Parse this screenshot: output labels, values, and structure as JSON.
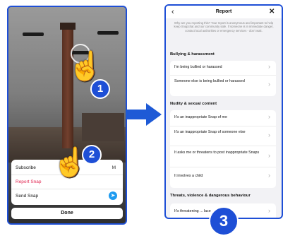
{
  "left_phone": {
    "action_sheet": {
      "subscribe": "Subscribe",
      "subscribe_count": "M",
      "report": "Report Snap",
      "send": "Send Snap",
      "done": "Done"
    }
  },
  "steps": [
    "1",
    "2",
    "3"
  ],
  "right_phone": {
    "title": "Report",
    "intro": "Why are you reporting this? Your report is anonymous and important to help keep Snapchat and our community safe. If someone is in immediate danger, contact local authorities or emergency services - don't wait.",
    "sections": [
      {
        "title": "Bullying & harassment",
        "options": [
          "I'm being bullied or harassed",
          "Someone else is being bullied or harassed"
        ]
      },
      {
        "title": "Nudity & sexual content",
        "options": [
          "It's an inappropriate Snap of me",
          "It's an inappropriate Snap of someone else",
          "It asks me or threatens to post inappropriate Snaps",
          "It involves a child"
        ]
      },
      {
        "title": "Threats, violence & dangerous behaviour",
        "options": [
          "It's threatening ... lace"
        ]
      }
    ]
  },
  "colors": {
    "accent": "#1e4fd6",
    "report_red": "#e0244f",
    "send_blue": "#1e9bf0"
  }
}
